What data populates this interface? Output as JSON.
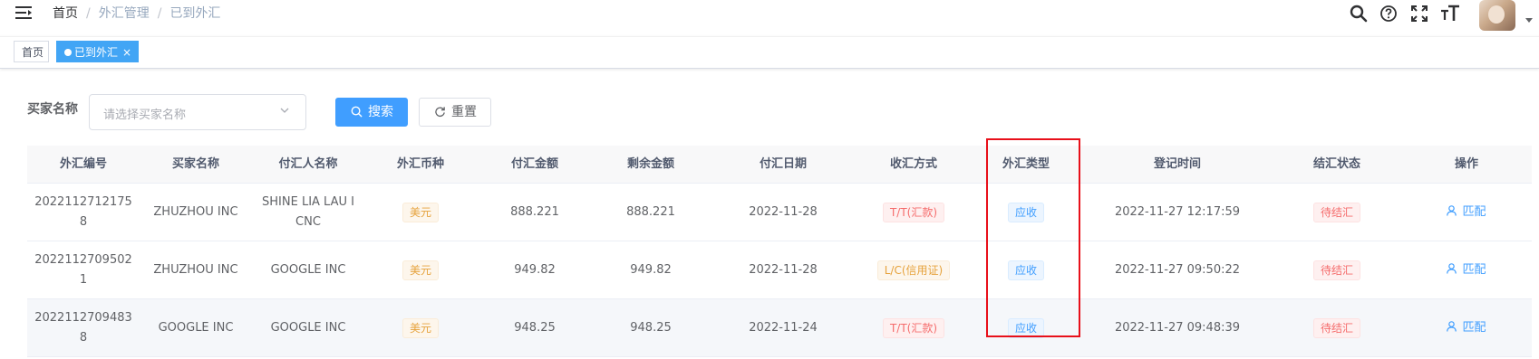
{
  "breadcrumb": [
    "首页",
    "外汇管理",
    "已到外汇"
  ],
  "breadcrumb_sep": "/",
  "navbar_icons": [
    "search-icon",
    "help-icon",
    "fullscreen-icon",
    "font-size-icon"
  ],
  "tags": {
    "home": "首页",
    "active": "已到外汇",
    "close": "×"
  },
  "filter": {
    "label": "买家名称",
    "placeholder": "请选择买家名称",
    "search_label": "搜索",
    "reset_label": "重置"
  },
  "colors": {
    "primary": "#409eff",
    "tag_active": "#42a5f5",
    "warning": "#e6a23c",
    "danger": "#f56c6c",
    "highlight_box": "#e8101a"
  },
  "table": {
    "headers": [
      "外汇编号",
      "买家名称",
      "付汇人名称",
      "外汇币种",
      "付汇金额",
      "剩余金额",
      "付汇日期",
      "收汇方式",
      "外汇类型",
      "登记时间",
      "结汇状态",
      "操作"
    ],
    "rows": [
      {
        "id": "20221127121758",
        "buyer": "ZHUZHOU INC",
        "payer": "SHINE LIA LAU I CNC",
        "currency": "美元",
        "amount": "888.221",
        "remaining": "888.221",
        "date": "2022-11-28",
        "method": "T/T(汇款)",
        "type": "应收",
        "registered": "2022-11-27 12:17:59",
        "status": "待结汇",
        "action": "匹配"
      },
      {
        "id": "20221127095021",
        "buyer": "ZHUZHOU INC",
        "payer": "GOOGLE INC",
        "currency": "美元",
        "amount": "949.82",
        "remaining": "949.82",
        "date": "2022-11-28",
        "method": "L/C(信用证)",
        "type": "应收",
        "registered": "2022-11-27 09:50:22",
        "status": "待结汇",
        "action": "匹配"
      },
      {
        "id": "20221127094838",
        "buyer": "GOOGLE INC",
        "payer": "GOOGLE INC",
        "currency": "美元",
        "amount": "948.25",
        "remaining": "948.25",
        "date": "2022-11-24",
        "method": "T/T(汇款)",
        "type": "应收",
        "registered": "2022-11-27 09:48:39",
        "status": "待结汇",
        "action": "匹配"
      }
    ]
  }
}
